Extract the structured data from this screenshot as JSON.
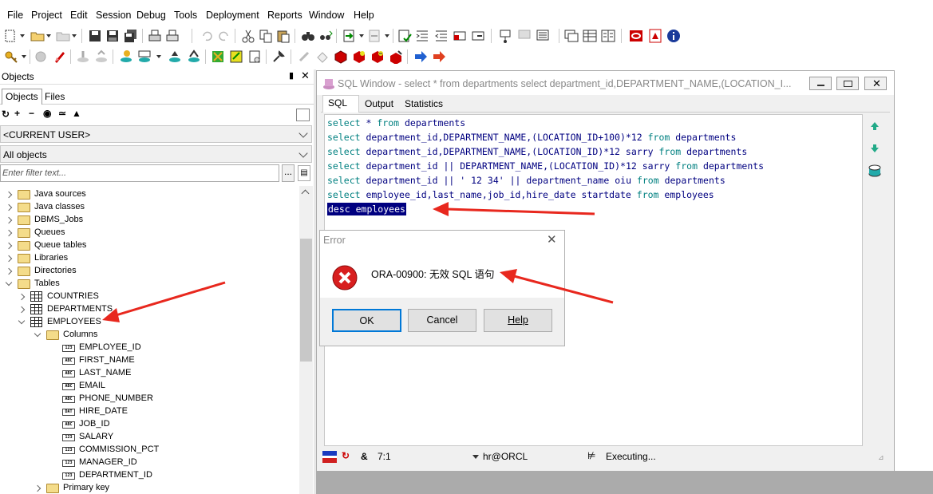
{
  "menu": [
    "File",
    "Project",
    "Edit",
    "Session",
    "Debug",
    "Tools",
    "Deployment",
    "Reports",
    "Window",
    "Help"
  ],
  "left": {
    "panel_title": "Objects",
    "tabs": [
      "Objects",
      "Files"
    ],
    "user_combo": "<CURRENT USER>",
    "filter_combo": "All objects",
    "filter_placeholder": "Enter filter text...",
    "tree": [
      {
        "label": "Java sources"
      },
      {
        "label": "Java classes"
      },
      {
        "label": "DBMS_Jobs"
      },
      {
        "label": "Queues"
      },
      {
        "label": "Queue tables"
      },
      {
        "label": "Libraries"
      },
      {
        "label": "Directories"
      },
      {
        "label": "Tables"
      },
      {
        "label": "COUNTRIES"
      },
      {
        "label": "DEPARTMENTS"
      },
      {
        "label": "EMPLOYEES"
      },
      {
        "label": "Columns"
      },
      {
        "label": "EMPLOYEE_ID",
        "type": "123"
      },
      {
        "label": "FIRST_NAME",
        "type": "ABC"
      },
      {
        "label": "LAST_NAME",
        "type": "ABC"
      },
      {
        "label": "EMAIL",
        "type": "ABC"
      },
      {
        "label": "PHONE_NUMBER",
        "type": "ABC"
      },
      {
        "label": "HIRE_DATE",
        "type": "DAT"
      },
      {
        "label": "JOB_ID",
        "type": "ABC"
      },
      {
        "label": "SALARY",
        "type": "123"
      },
      {
        "label": "COMMISSION_PCT",
        "type": "123"
      },
      {
        "label": "MANAGER_ID",
        "type": "123"
      },
      {
        "label": "DEPARTMENT_ID",
        "type": "123"
      },
      {
        "label": "Primary key"
      }
    ]
  },
  "sql_window": {
    "title": "SQL Window - select * from departments select department_id,DEPARTMENT_NAME,(LOCATION_I...",
    "tabs": [
      "SQL",
      "Output",
      "Statistics"
    ],
    "lines": [
      "select * from departments",
      "select department_id,DEPARTMENT_NAME,(LOCATION_ID+100)*12 from departments",
      "select department_id,DEPARTMENT_NAME,(LOCATION_ID)*12 sarry from departments",
      "select department_id || DEPARTMENT_NAME,(LOCATION_ID)*12 sarry from departments",
      "select department_id || ' 12 34' || department_name oiu from departments",
      "select employee_id,last_name,job_id,hire_date startdate from employees",
      "desc employees"
    ],
    "status": {
      "amp": "&",
      "position": "7:1",
      "connection": "hr@ORCL",
      "state": "Executing..."
    }
  },
  "error_dialog": {
    "title": "Error",
    "message": "ORA-00900: 无效 SQL 语句",
    "buttons": [
      "OK",
      "Cancel",
      "Help"
    ]
  },
  "colors": {
    "arrow": "#e8281e",
    "selection": "#000080",
    "keyword": "#008080"
  }
}
